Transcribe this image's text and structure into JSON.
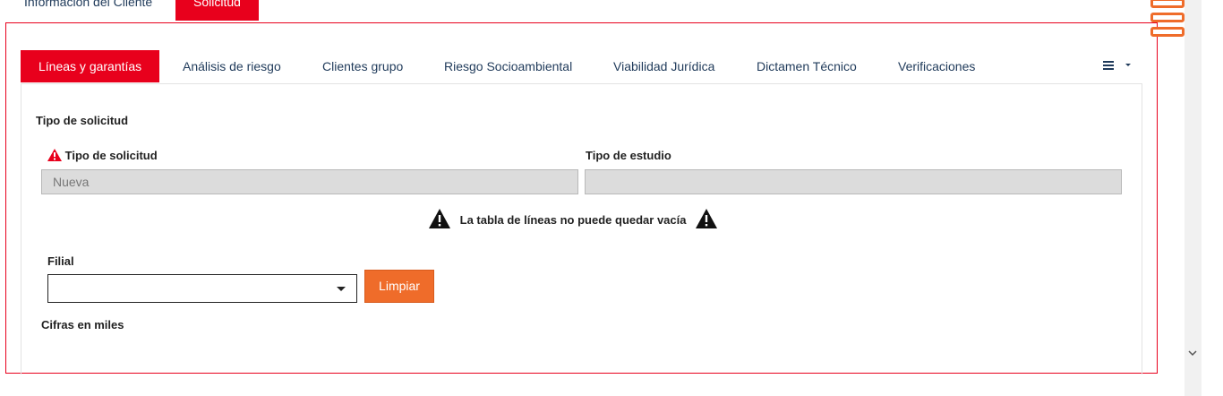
{
  "top_tabs": [
    {
      "label": "Información del Cliente",
      "active": false
    },
    {
      "label": "Solicitud",
      "active": true
    }
  ],
  "sub_tabs": [
    {
      "label": "Líneas y garantías",
      "active": true
    },
    {
      "label": "Análisis de riesgo",
      "active": false
    },
    {
      "label": "Clientes grupo",
      "active": false
    },
    {
      "label": "Riesgo Socioambiental",
      "active": false
    },
    {
      "label": "Viabilidad Jurídica",
      "active": false
    },
    {
      "label": "Dictamen Técnico",
      "active": false
    },
    {
      "label": "Verificaciones",
      "active": false
    }
  ],
  "sub_tabs_menu_icon": "list-dropdown-icon",
  "section": {
    "title": "Tipo de solicitud",
    "tipo_solicitud_label": "Tipo de solicitud",
    "tipo_solicitud_value": "Nueva",
    "tipo_estudio_label": "Tipo de estudio",
    "tipo_estudio_value": ""
  },
  "notice": {
    "text": "La tabla de líneas no puede quedar vacía",
    "icon": "warning-triangle-icon"
  },
  "filial": {
    "label": "Filial",
    "value": "",
    "button_label": "Limpiar"
  },
  "cifras_label": "Cifras en miles",
  "colors": {
    "accent_red": "#e8001c",
    "accent_orange": "#ef6c2a",
    "link_blue": "#1f3a5a"
  }
}
